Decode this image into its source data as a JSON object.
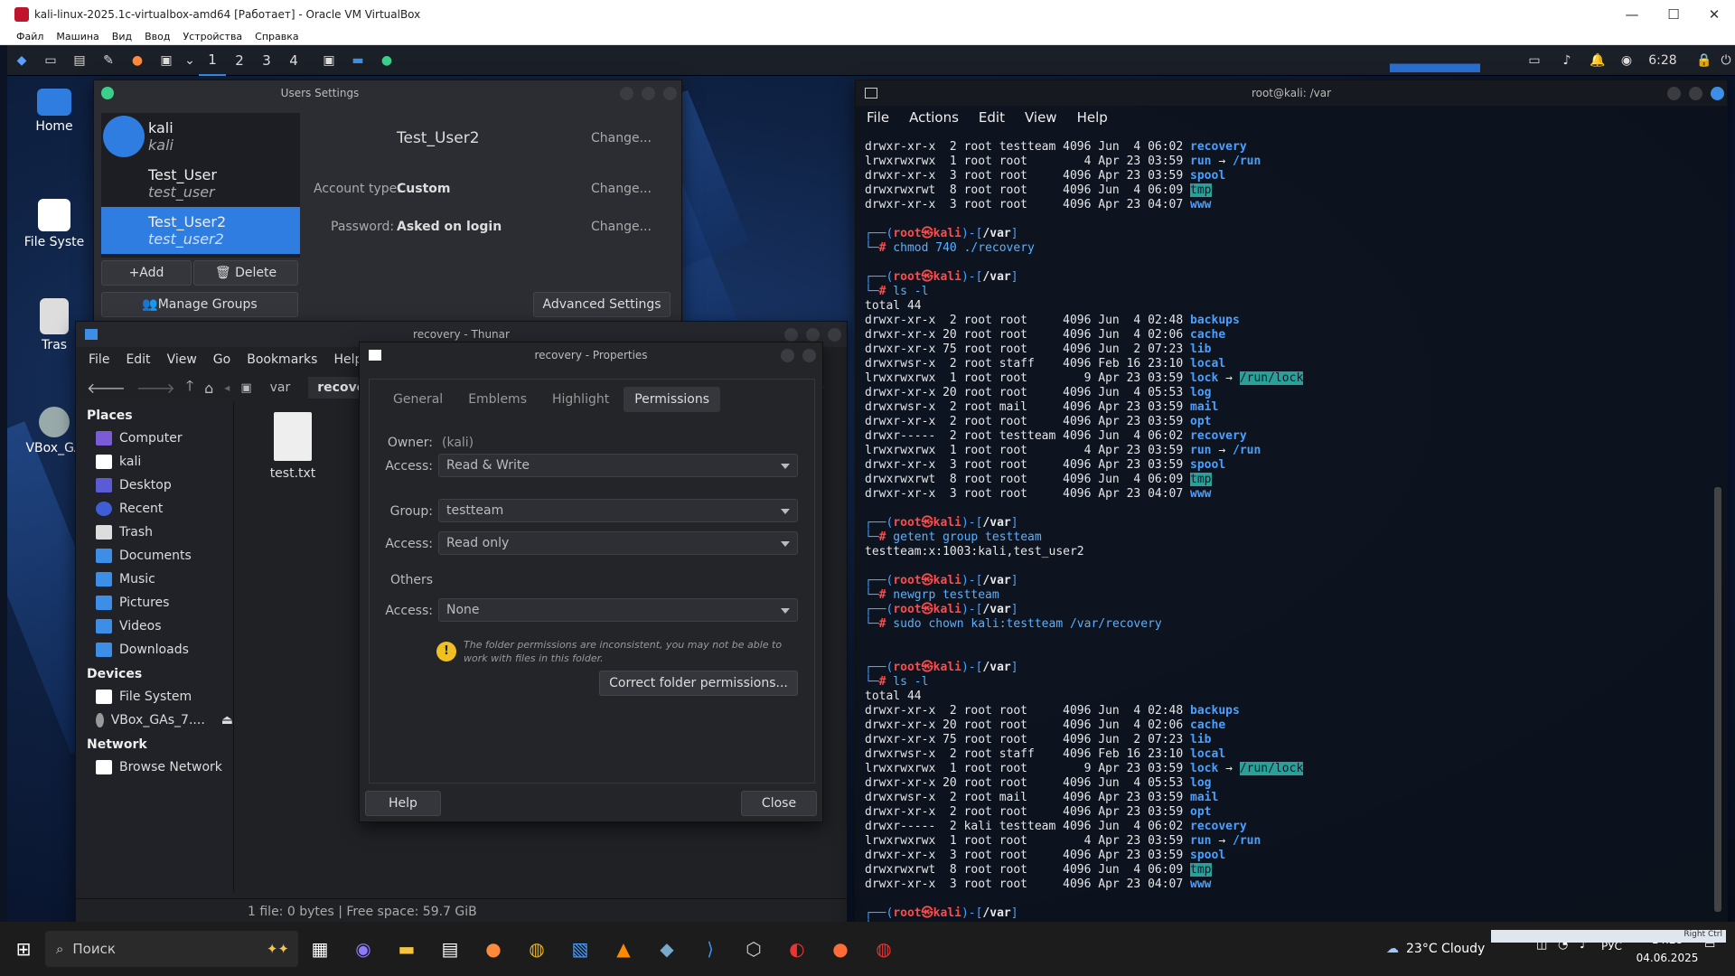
{
  "host": {
    "title": "kali-linux-2025.1c-virtualbox-amd64 [Работает] - Oracle VM VirtualBox",
    "menu": [
      "Файл",
      "Машина",
      "Вид",
      "Ввод",
      "Устройства",
      "Справка"
    ]
  },
  "panel": {
    "workspaces": [
      "1",
      "2",
      "3",
      "4"
    ],
    "clock": "6:28"
  },
  "desktop": {
    "icons": [
      "Home",
      "File Syste",
      "Tras",
      "VBox_GA"
    ]
  },
  "users_settings": {
    "title": "Users Settings",
    "users": [
      {
        "name": "kali",
        "login": "kali"
      },
      {
        "name": "Test_User",
        "login": "test_user"
      },
      {
        "name": "Test_User2",
        "login": "test_user2"
      }
    ],
    "add_label": "+Add",
    "delete_label": "Delete",
    "manage_groups_label": "Manage Groups",
    "advanced_label": "Advanced Settings",
    "selected_name": "Test_User2",
    "change_label": "Change...",
    "account_type_label": "Account type:",
    "account_type_value": "Custom",
    "password_label": "Password:",
    "password_value": "Asked on login"
  },
  "thunar": {
    "title": "recovery - Thunar",
    "menu": [
      "File",
      "Edit",
      "View",
      "Go",
      "Bookmarks",
      "Help"
    ],
    "path": [
      "var",
      "recovery"
    ],
    "places_header": "Places",
    "places": [
      "Computer",
      "kali",
      "Desktop",
      "Recent",
      "Trash",
      "Documents",
      "Music",
      "Pictures",
      "Videos",
      "Downloads"
    ],
    "devices_header": "Devices",
    "devices": [
      "File System",
      "VBox_GAs_7...."
    ],
    "network_header": "Network",
    "network": [
      "Browse Network"
    ],
    "file_name": "test.txt",
    "status": "1 file: 0 bytes  |  Free space: 59.7 GiB"
  },
  "properties": {
    "title": "recovery - Properties",
    "tabs": [
      "General",
      "Emblems",
      "Highlight",
      "Permissions"
    ],
    "owner_label": "Owner:",
    "owner_value": "(kali)",
    "access_label": "Access:",
    "owner_access": "Read & Write",
    "group_label": "Group:",
    "group_value": "testteam",
    "group_access": "Read only",
    "others_label": "Others",
    "others_access": "None",
    "warning": "The folder permissions are inconsistent, you may not be able to work with files in this folder.",
    "correct_label": "Correct folder permissions...",
    "help_label": "Help",
    "close_label": "Close"
  },
  "terminal": {
    "title": "root@kali: /var",
    "menu": [
      "File",
      "Actions",
      "Edit",
      "View",
      "Help"
    ],
    "lines": [
      "drwxr-xr-x  2 root testteam 4096 Jun  4 06:02 |recovery",
      "lrwxrwxrwx  1 root root        4 Apr 23 03:59 |run → /run",
      "drwxr-xr-x  3 root root     4096 Apr 23 03:59 |spool",
      "drwxrwxrwt  8 root root     4096 Jun  4 06:09 |tmp",
      "drwxr-xr-x  3 root root     4096 Apr 23 04:07 |www",
      "",
      "┌──(root㉿kali)-[/var]",
      "└─# chmod 740 ./recovery",
      "",
      "┌──(root㉿kali)-[/var]",
      "└─# ls -l",
      "total 44",
      "drwxr-xr-x  2 root root     4096 Jun  4 02:48 |backups",
      "drwxr-xr-x 20 root root     4096 Jun  4 02:06 |cache",
      "drwxr-xr-x 75 root root     4096 Jun  2 07:23 |lib",
      "drwxrwsr-x  2 root staff    4096 Feb 16 23:10 |local",
      "lrwxrwxrwx  1 root root        9 Apr 23 03:59 |lock → /run/lock",
      "drwxr-xr-x 20 root root     4096 Jun  4 05:53 |log",
      "drwxrwsr-x  2 root mail     4096 Apr 23 03:59 |mail",
      "drwxr-xr-x  2 root root     4096 Apr 23 03:59 |opt",
      "drwxr-----  2 root testteam 4096 Jun  4 06:02 |recovery",
      "lrwxrwxrwx  1 root root        4 Apr 23 03:59 |run → /run",
      "drwxr-xr-x  3 root root     4096 Apr 23 03:59 |spool",
      "drwxrwxrwt  8 root root     4096 Jun  4 06:09 |tmp",
      "drwxr-xr-x  3 root root     4096 Apr 23 04:07 |www",
      "",
      "┌──(root㉿kali)-[/var]",
      "└─# getent group testteam",
      "testteam:x:1003:kali,test_user2",
      "",
      "┌──(root㉿kali)-[/var]",
      "└─# newgrp testteam",
      "┌──(root㉿kali)-[/var]",
      "└─# sudo chown kali:testteam /var/recovery",
      "",
      "",
      "┌──(root㉿kali)-[/var]",
      "└─# ls -l",
      "total 44",
      "drwxr-xr-x  2 root root     4096 Jun  4 02:48 |backups",
      "drwxr-xr-x 20 root root     4096 Jun  4 02:06 |cache",
      "drwxr-xr-x 75 root root     4096 Jun  2 07:23 |lib",
      "drwxrwsr-x  2 root staff    4096 Feb 16 23:10 |local",
      "lrwxrwxrwx  1 root root        9 Apr 23 03:59 |lock → /run/lock",
      "drwxr-xr-x 20 root root     4096 Jun  4 05:53 |log",
      "drwxrwsr-x  2 root mail     4096 Apr 23 03:59 |mail",
      "drwxr-xr-x  2 root root     4096 Apr 23 03:59 |opt",
      "drwxr-----  2 kali testteam 4096 Jun  4 06:02 |recovery",
      "lrwxrwxrwx  1 root root        4 Apr 23 03:59 |run → /run",
      "drwxr-xr-x  3 root root     4096 Apr 23 03:59 |spool",
      "drwxrwxrwt  8 root root     4096 Jun  4 06:09 |tmp",
      "drwxr-xr-x  3 root root     4096 Apr 23 04:07 |www",
      "",
      "┌──(root㉿kali)-[/var]",
      "└─# "
    ]
  },
  "taskbar": {
    "search_placeholder": "Поиск",
    "weather": "23°C  Cloudy",
    "lang": "РУС",
    "time": "14:28",
    "date": "04.06.2025",
    "vbox_hint": "Right Ctrl"
  },
  "colors": {
    "accent": "#2f7de0",
    "term_blue": "#4aa0ff",
    "term_red": "#ff4a4a",
    "tmp_bg": "#2aa198"
  }
}
